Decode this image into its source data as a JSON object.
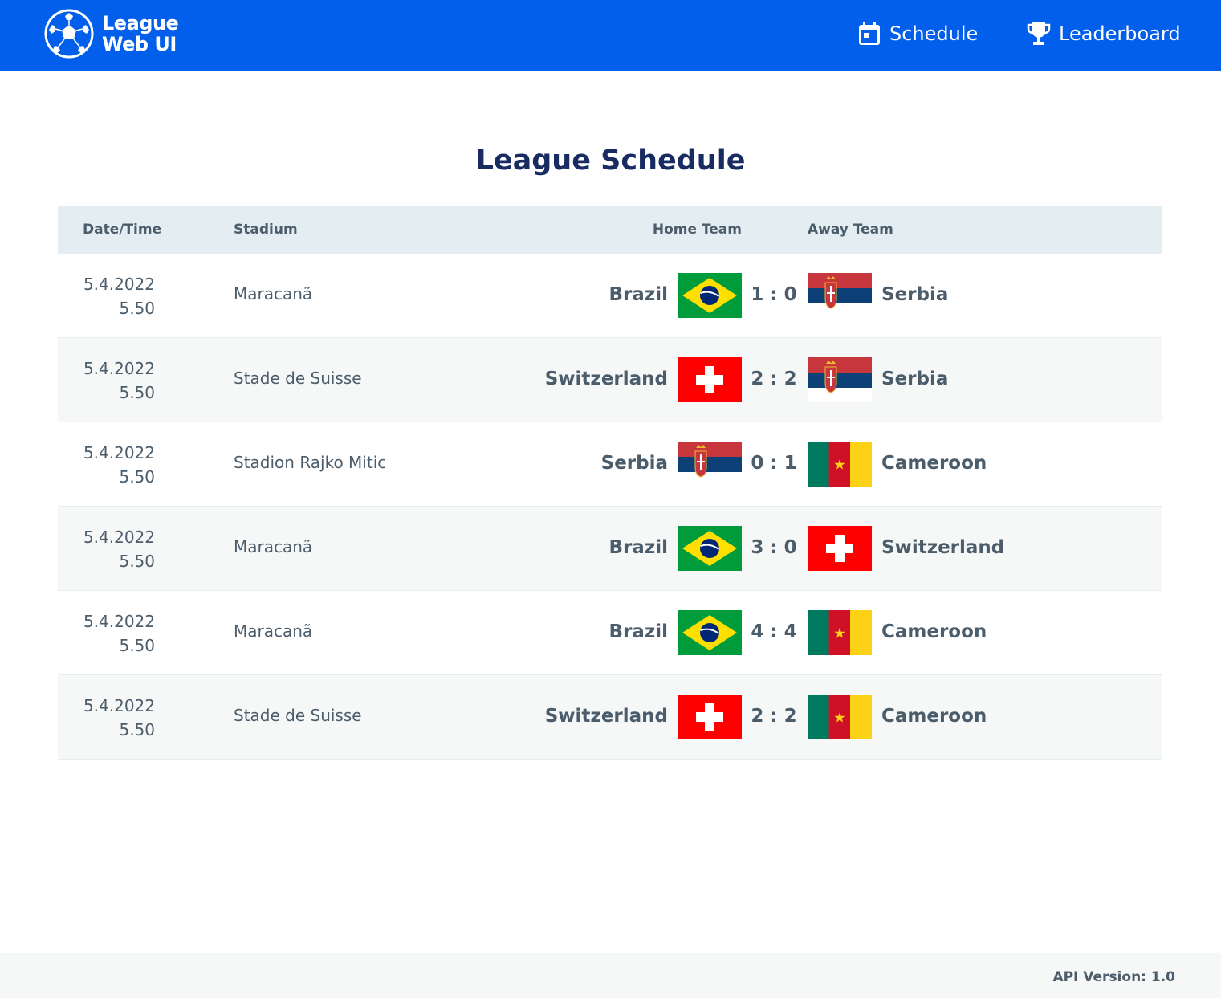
{
  "brand": {
    "name_line1": "League",
    "name_line2": "Web UI",
    "logo_icon": "football-icon",
    "color": "#025feb"
  },
  "nav": {
    "schedule": {
      "label": "Schedule",
      "icon": "calendar-icon"
    },
    "leaderboard": {
      "label": "Leaderboard",
      "icon": "trophy-icon"
    }
  },
  "page": {
    "title": "League Schedule"
  },
  "table": {
    "headers": {
      "date": "Date/Time",
      "stadium": "Stadium",
      "home": "Home Team",
      "away": "Away Team"
    },
    "rows": [
      {
        "date": "5.4.2022",
        "time": "5.50",
        "stadium": "Maracanã",
        "home": "Brazil",
        "home_flag": "brazil",
        "score": "1 : 0",
        "away": "Serbia",
        "away_flag": "serbia"
      },
      {
        "date": "5.4.2022",
        "time": "5.50",
        "stadium": "Stade de Suisse",
        "home": "Switzerland",
        "home_flag": "switzerland",
        "score": "2 : 2",
        "away": "Serbia",
        "away_flag": "serbia"
      },
      {
        "date": "5.4.2022",
        "time": "5.50",
        "stadium": "Stadion Rajko Mitic",
        "home": "Serbia",
        "home_flag": "serbia",
        "score": "0 : 1",
        "away": "Cameroon",
        "away_flag": "cameroon"
      },
      {
        "date": "5.4.2022",
        "time": "5.50",
        "stadium": "Maracanã",
        "home": "Brazil",
        "home_flag": "brazil",
        "score": "3 : 0",
        "away": "Switzerland",
        "away_flag": "switzerland"
      },
      {
        "date": "5.4.2022",
        "time": "5.50",
        "stadium": "Maracanã",
        "home": "Brazil",
        "home_flag": "brazil",
        "score": "4 : 4",
        "away": "Cameroon",
        "away_flag": "cameroon"
      },
      {
        "date": "5.4.2022",
        "time": "5.50",
        "stadium": "Stade de Suisse",
        "home": "Switzerland",
        "home_flag": "switzerland",
        "score": "2 : 2",
        "away": "Cameroon",
        "away_flag": "cameroon"
      }
    ]
  },
  "footer": {
    "api_version": "API Version: 1.0"
  }
}
